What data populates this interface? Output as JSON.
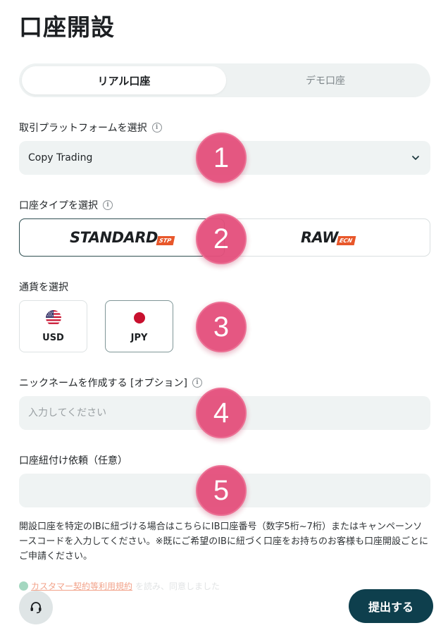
{
  "page": {
    "title": "口座開設"
  },
  "tabs": {
    "real": "リアル口座",
    "demo": "デモ口座",
    "active": "real"
  },
  "platform": {
    "label": "取引プラットフォームを選択",
    "value": "Copy Trading"
  },
  "account_type": {
    "label": "口座タイプを選択",
    "options": [
      {
        "name": "STANDARD",
        "tag": "STP"
      },
      {
        "name": "RAW",
        "tag": "ECN"
      }
    ],
    "selected": "STANDARD"
  },
  "currency": {
    "label": "通貨を選択",
    "options": [
      {
        "code": "USD",
        "flag": "us-flag-icon"
      },
      {
        "code": "JPY",
        "flag": "jp-flag-icon"
      }
    ],
    "selected": "JPY"
  },
  "nickname": {
    "label": "ニックネームを作成する [オプション]",
    "placeholder": "入力してください",
    "value": ""
  },
  "ib_link": {
    "label": "口座紐付け依頼（任意）",
    "value": "",
    "help": "開設口座を特定のIBに紐づける場合はこちらにIB口座番号（数字5桁~7桁）またはキャンペーンソースコードを入力してください。※既にご希望のIBに紐づく口座をお持ちのお客様も口座開設ごとにご申請ください。"
  },
  "consent": {
    "link_text": "カスタマー契約等利用規約",
    "suffix": "を読み、同意しました"
  },
  "submit": {
    "label": "提出する"
  },
  "markers": [
    "1",
    "2",
    "3",
    "4",
    "5"
  ],
  "colors": {
    "primary": "#0e3f4d",
    "marker": "#e4517d",
    "accent": "#e8572a",
    "field_bg": "#eff3f3"
  }
}
